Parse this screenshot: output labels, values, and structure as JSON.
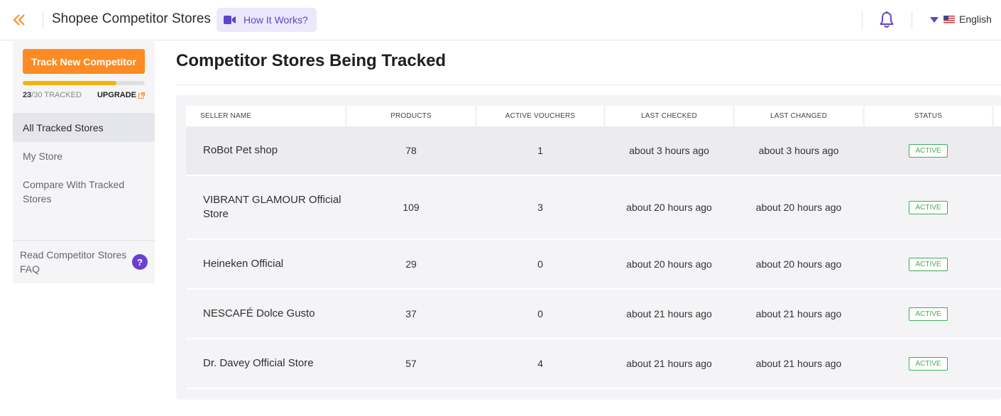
{
  "header": {
    "title": "Shopee Competitor Stores",
    "how_it_works": "How It Works?",
    "language": "English"
  },
  "sidebar": {
    "track_button": "Track New Competitor",
    "tracked_used": "23",
    "tracked_total": "/30 TRACKED",
    "tracked_fraction": 0.767,
    "upgrade": "UPGRADE",
    "nav": [
      {
        "label": "All Tracked Stores",
        "active": true
      },
      {
        "label": "My Store",
        "active": false
      },
      {
        "label": "Compare With Tracked Stores",
        "active": false
      }
    ],
    "faq": "Read Competitor Stores FAQ",
    "faq_icon": "?"
  },
  "main": {
    "title": "Competitor Stores Being Tracked",
    "columns": [
      "SELLER NAME",
      "PRODUCTS",
      "ACTIVE VOUCHERS",
      "LAST CHECKED",
      "LAST CHANGED",
      "STATUS"
    ],
    "rows": [
      {
        "name": "RoBot Pet shop",
        "products": "78",
        "vouchers": "1",
        "checked": "about 3 hours ago",
        "changed": "about 3 hours ago",
        "status": "ACTIVE"
      },
      {
        "name": "VIBRANT GLAMOUR Official Store",
        "products": "109",
        "vouchers": "3",
        "checked": "about 20 hours ago",
        "changed": "about 20 hours ago",
        "status": "ACTIVE"
      },
      {
        "name": "Heineken Official",
        "products": "29",
        "vouchers": "0",
        "checked": "about 20 hours ago",
        "changed": "about 20 hours ago",
        "status": "ACTIVE"
      },
      {
        "name": "NESCAFÉ Dolce Gusto",
        "products": "37",
        "vouchers": "0",
        "checked": "about 21 hours ago",
        "changed": "about 21 hours ago",
        "status": "ACTIVE"
      },
      {
        "name": "Dr. Davey Official Store",
        "products": "57",
        "vouchers": "4",
        "checked": "about 21 hours ago",
        "changed": "about 21 hours ago",
        "status": "ACTIVE"
      }
    ]
  },
  "colors": {
    "accent_orange": "#fd8b23",
    "accent_purple": "#5d45c9",
    "status_green": "#3fae52",
    "progress": "#f4b20c"
  },
  "icons": {
    "back": "double-chevron-left-icon",
    "video": "video-camera-icon",
    "bell": "bell-icon",
    "flag": "us-flag-icon",
    "external": "external-link-icon"
  }
}
